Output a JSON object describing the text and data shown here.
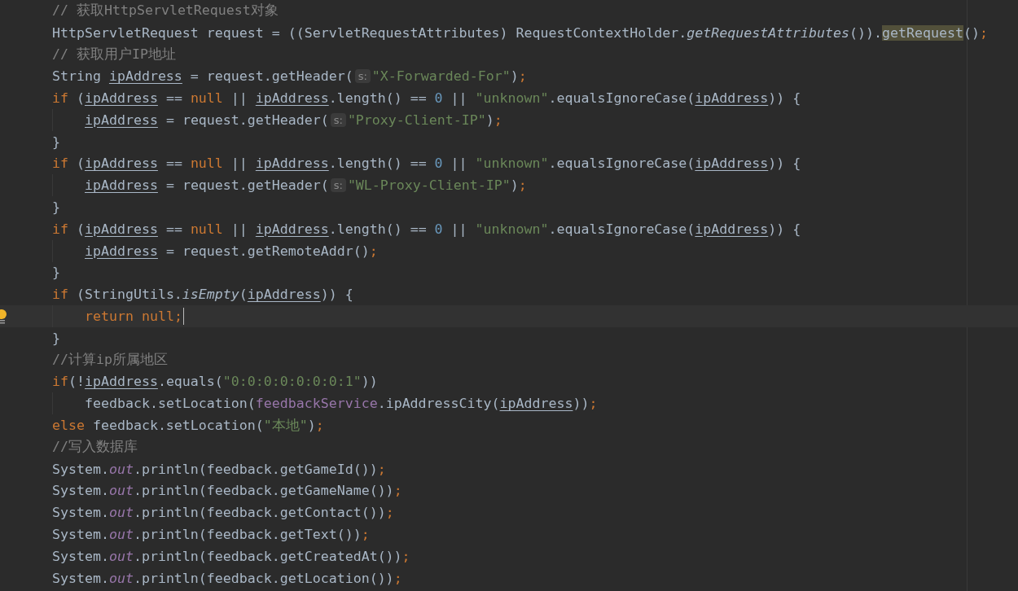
{
  "editor": {
    "lines": [
      {
        "indented": false,
        "current": false,
        "caret": false,
        "tokens": [
          {
            "kind": "comment",
            "text": "// 获取HttpServletRequest对象"
          }
        ]
      },
      {
        "indented": false,
        "current": false,
        "caret": false,
        "tokens": [
          {
            "kind": "plain",
            "text": "HttpServletRequest request = ((ServletRequestAttributes) RequestContextHolder."
          },
          {
            "kind": "static-method",
            "text": "getRequestAttributes"
          },
          {
            "kind": "plain",
            "text": "())."
          },
          {
            "kind": "match",
            "text": "getRequest"
          },
          {
            "kind": "plain",
            "text": "()"
          },
          {
            "kind": "keyword",
            "text": ";"
          }
        ]
      },
      {
        "indented": false,
        "current": false,
        "caret": false,
        "tokens": [
          {
            "kind": "comment",
            "text": "// 获取用户IP地址"
          }
        ]
      },
      {
        "indented": false,
        "current": false,
        "caret": false,
        "tokens": [
          {
            "kind": "plain",
            "text": "String "
          },
          {
            "kind": "variable",
            "text": "ipAddress"
          },
          {
            "kind": "plain",
            "text": " = request.getHeader("
          },
          {
            "kind": "hint",
            "text": "s:"
          },
          {
            "kind": "string",
            "text": "\"X-Forwarded-For\""
          },
          {
            "kind": "plain",
            "text": ")"
          },
          {
            "kind": "keyword",
            "text": ";"
          }
        ]
      },
      {
        "indented": false,
        "current": false,
        "caret": false,
        "tokens": [
          {
            "kind": "keyword",
            "text": "if "
          },
          {
            "kind": "plain",
            "text": "("
          },
          {
            "kind": "variable",
            "text": "ipAddress"
          },
          {
            "kind": "plain",
            "text": " == "
          },
          {
            "kind": "keyword",
            "text": "null"
          },
          {
            "kind": "plain",
            "text": " || "
          },
          {
            "kind": "variable",
            "text": "ipAddress"
          },
          {
            "kind": "plain",
            "text": ".length() == "
          },
          {
            "kind": "number",
            "text": "0"
          },
          {
            "kind": "plain",
            "text": " || "
          },
          {
            "kind": "string",
            "text": "\"unknown\""
          },
          {
            "kind": "plain",
            "text": ".equalsIgnoreCase("
          },
          {
            "kind": "variable",
            "text": "ipAddress"
          },
          {
            "kind": "plain",
            "text": ")) {"
          }
        ]
      },
      {
        "indented": true,
        "current": false,
        "caret": false,
        "tokens": [
          {
            "kind": "variable",
            "text": "ipAddress"
          },
          {
            "kind": "plain",
            "text": " = request.getHeader("
          },
          {
            "kind": "hint",
            "text": "s:"
          },
          {
            "kind": "string",
            "text": "\"Proxy-Client-IP\""
          },
          {
            "kind": "plain",
            "text": ")"
          },
          {
            "kind": "keyword",
            "text": ";"
          }
        ]
      },
      {
        "indented": false,
        "current": false,
        "caret": false,
        "tokens": [
          {
            "kind": "plain",
            "text": "}"
          }
        ]
      },
      {
        "indented": false,
        "current": false,
        "caret": false,
        "tokens": [
          {
            "kind": "keyword",
            "text": "if "
          },
          {
            "kind": "plain",
            "text": "("
          },
          {
            "kind": "variable",
            "text": "ipAddress"
          },
          {
            "kind": "plain",
            "text": " == "
          },
          {
            "kind": "keyword",
            "text": "null"
          },
          {
            "kind": "plain",
            "text": " || "
          },
          {
            "kind": "variable",
            "text": "ipAddress"
          },
          {
            "kind": "plain",
            "text": ".length() == "
          },
          {
            "kind": "number",
            "text": "0"
          },
          {
            "kind": "plain",
            "text": " || "
          },
          {
            "kind": "string",
            "text": "\"unknown\""
          },
          {
            "kind": "plain",
            "text": ".equalsIgnoreCase("
          },
          {
            "kind": "variable",
            "text": "ipAddress"
          },
          {
            "kind": "plain",
            "text": ")) {"
          }
        ]
      },
      {
        "indented": true,
        "current": false,
        "caret": false,
        "tokens": [
          {
            "kind": "variable",
            "text": "ipAddress"
          },
          {
            "kind": "plain",
            "text": " = request.getHeader("
          },
          {
            "kind": "hint",
            "text": "s:"
          },
          {
            "kind": "string",
            "text": "\"WL-Proxy-Client-IP\""
          },
          {
            "kind": "plain",
            "text": ")"
          },
          {
            "kind": "keyword",
            "text": ";"
          }
        ]
      },
      {
        "indented": false,
        "current": false,
        "caret": false,
        "tokens": [
          {
            "kind": "plain",
            "text": "}"
          }
        ]
      },
      {
        "indented": false,
        "current": false,
        "caret": false,
        "tokens": [
          {
            "kind": "keyword",
            "text": "if "
          },
          {
            "kind": "plain",
            "text": "("
          },
          {
            "kind": "variable",
            "text": "ipAddress"
          },
          {
            "kind": "plain",
            "text": " == "
          },
          {
            "kind": "keyword",
            "text": "null"
          },
          {
            "kind": "plain",
            "text": " || "
          },
          {
            "kind": "variable",
            "text": "ipAddress"
          },
          {
            "kind": "plain",
            "text": ".length() == "
          },
          {
            "kind": "number",
            "text": "0"
          },
          {
            "kind": "plain",
            "text": " || "
          },
          {
            "kind": "string",
            "text": "\"unknown\""
          },
          {
            "kind": "plain",
            "text": ".equalsIgnoreCase("
          },
          {
            "kind": "variable",
            "text": "ipAddress"
          },
          {
            "kind": "plain",
            "text": ")) {"
          }
        ]
      },
      {
        "indented": true,
        "current": false,
        "caret": false,
        "tokens": [
          {
            "kind": "variable",
            "text": "ipAddress"
          },
          {
            "kind": "plain",
            "text": " = request.getRemoteAddr()"
          },
          {
            "kind": "keyword",
            "text": ";"
          }
        ]
      },
      {
        "indented": false,
        "current": false,
        "caret": false,
        "tokens": [
          {
            "kind": "plain",
            "text": "}"
          }
        ]
      },
      {
        "indented": false,
        "current": false,
        "caret": false,
        "tokens": [
          {
            "kind": "keyword",
            "text": "if "
          },
          {
            "kind": "plain",
            "text": "(StringUtils."
          },
          {
            "kind": "static-method",
            "text": "isEmpty"
          },
          {
            "kind": "plain",
            "text": "("
          },
          {
            "kind": "variable",
            "text": "ipAddress"
          },
          {
            "kind": "plain",
            "text": ")) {"
          }
        ]
      },
      {
        "indented": true,
        "current": true,
        "caret": true,
        "tokens": [
          {
            "kind": "keyword",
            "text": "return null;"
          }
        ]
      },
      {
        "indented": false,
        "current": false,
        "caret": false,
        "tokens": [
          {
            "kind": "plain",
            "text": "}"
          }
        ]
      },
      {
        "indented": false,
        "current": false,
        "caret": false,
        "tokens": [
          {
            "kind": "comment",
            "text": "//计算ip所属地区"
          }
        ]
      },
      {
        "indented": false,
        "current": false,
        "caret": false,
        "tokens": [
          {
            "kind": "keyword",
            "text": "if"
          },
          {
            "kind": "plain",
            "text": "(!"
          },
          {
            "kind": "variable",
            "text": "ipAddress"
          },
          {
            "kind": "plain",
            "text": ".equals("
          },
          {
            "kind": "string",
            "text": "\"0:0:0:0:0:0:0:1\""
          },
          {
            "kind": "plain",
            "text": "))"
          }
        ]
      },
      {
        "indented": true,
        "current": false,
        "caret": false,
        "tokens": [
          {
            "kind": "plain",
            "text": "feedback.setLocation("
          },
          {
            "kind": "field",
            "text": "feedbackService"
          },
          {
            "kind": "plain",
            "text": ".ipAddressCity("
          },
          {
            "kind": "variable",
            "text": "ipAddress"
          },
          {
            "kind": "plain",
            "text": "))"
          },
          {
            "kind": "keyword",
            "text": ";"
          }
        ]
      },
      {
        "indented": false,
        "current": false,
        "caret": false,
        "tokens": [
          {
            "kind": "keyword",
            "text": "else "
          },
          {
            "kind": "plain",
            "text": "feedback.setLocation("
          },
          {
            "kind": "string",
            "text": "\"本地\""
          },
          {
            "kind": "plain",
            "text": ")"
          },
          {
            "kind": "keyword",
            "text": ";"
          }
        ]
      },
      {
        "indented": false,
        "current": false,
        "caret": false,
        "tokens": [
          {
            "kind": "comment",
            "text": "//写入数据库"
          }
        ]
      },
      {
        "indented": false,
        "current": false,
        "caret": false,
        "tokens": [
          {
            "kind": "plain",
            "text": "System."
          },
          {
            "kind": "static-field",
            "text": "out"
          },
          {
            "kind": "plain",
            "text": ".println(feedback.getGameId())"
          },
          {
            "kind": "keyword",
            "text": ";"
          }
        ]
      },
      {
        "indented": false,
        "current": false,
        "caret": false,
        "tokens": [
          {
            "kind": "plain",
            "text": "System."
          },
          {
            "kind": "static-field",
            "text": "out"
          },
          {
            "kind": "plain",
            "text": ".println(feedback.getGameName())"
          },
          {
            "kind": "keyword",
            "text": ";"
          }
        ]
      },
      {
        "indented": false,
        "current": false,
        "caret": false,
        "tokens": [
          {
            "kind": "plain",
            "text": "System."
          },
          {
            "kind": "static-field",
            "text": "out"
          },
          {
            "kind": "plain",
            "text": ".println(feedback.getContact())"
          },
          {
            "kind": "keyword",
            "text": ";"
          }
        ]
      },
      {
        "indented": false,
        "current": false,
        "caret": false,
        "tokens": [
          {
            "kind": "plain",
            "text": "System."
          },
          {
            "kind": "static-field",
            "text": "out"
          },
          {
            "kind": "plain",
            "text": ".println(feedback.getText())"
          },
          {
            "kind": "keyword",
            "text": ";"
          }
        ]
      },
      {
        "indented": false,
        "current": false,
        "caret": false,
        "tokens": [
          {
            "kind": "plain",
            "text": "System."
          },
          {
            "kind": "static-field",
            "text": "out"
          },
          {
            "kind": "plain",
            "text": ".println(feedback.getCreatedAt())"
          },
          {
            "kind": "keyword",
            "text": ";"
          }
        ]
      },
      {
        "indented": false,
        "current": false,
        "caret": false,
        "tokens": [
          {
            "kind": "plain",
            "text": "System."
          },
          {
            "kind": "static-field",
            "text": "out"
          },
          {
            "kind": "plain",
            "text": ".println(feedback.getLocation())"
          },
          {
            "kind": "keyword",
            "text": ";"
          }
        ]
      }
    ]
  }
}
